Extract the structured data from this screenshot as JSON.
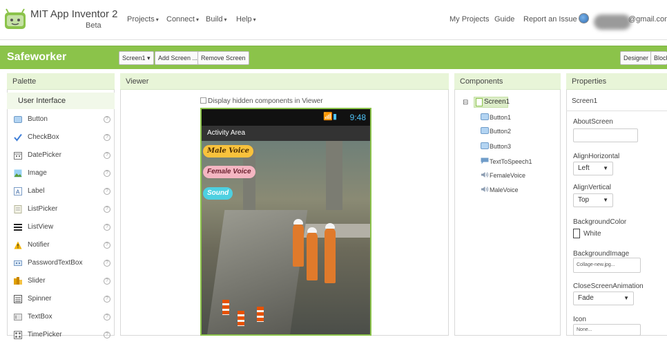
{
  "header": {
    "app_title": "MIT App Inventor 2",
    "beta": "Beta",
    "menus": [
      "Projects",
      "Connect",
      "Build",
      "Help"
    ],
    "right_links": [
      "My Projects",
      "Guide",
      "Report an Issue"
    ],
    "account": "@gmail.com"
  },
  "project": {
    "name": "Safeworker",
    "screen_select": "Screen1",
    "add_screen": "Add Screen ...",
    "remove_screen": "Remove Screen",
    "designer": "Designer",
    "blocks": "Block"
  },
  "palette": {
    "title": "Palette",
    "section": "User Interface",
    "items": [
      "Button",
      "CheckBox",
      "DatePicker",
      "Image",
      "Label",
      "ListPicker",
      "ListView",
      "Notifier",
      "PasswordTextBox",
      "Slider",
      "Spinner",
      "TextBox",
      "TimePicker"
    ],
    "help_glyph": "?"
  },
  "viewer": {
    "title": "Viewer",
    "hidden_checkbox": "Display hidden components in Viewer",
    "status_time": "9:48",
    "app_bar_title": "Activity Area",
    "buttons": [
      "Male Voice",
      "Female Voice",
      "Sound"
    ]
  },
  "components": {
    "title": "Components",
    "root": "Screen1",
    "children": [
      "Button1",
      "Button2",
      "Button3",
      "TextToSpeech1",
      "FemaleVoice",
      "MaleVoice"
    ]
  },
  "properties": {
    "title": "Properties",
    "component": "Screen1",
    "about_label": "AboutScreen",
    "about_value": "",
    "align_h_label": "AlignHorizontal",
    "align_h_value": "Left",
    "align_v_label": "AlignVertical",
    "align_v_value": "Top",
    "bg_color_label": "BackgroundColor",
    "bg_color_value": "White",
    "bg_image_label": "BackgroundImage",
    "bg_image_value": "Collage-new.jpg...",
    "close_anim_label": "CloseScreenAnimation",
    "close_anim_value": "Fade",
    "icon_label": "Icon",
    "icon_value": "None..."
  },
  "colors": {
    "brand_green": "#8bc34a",
    "panel_header": "#e8f5d8"
  }
}
